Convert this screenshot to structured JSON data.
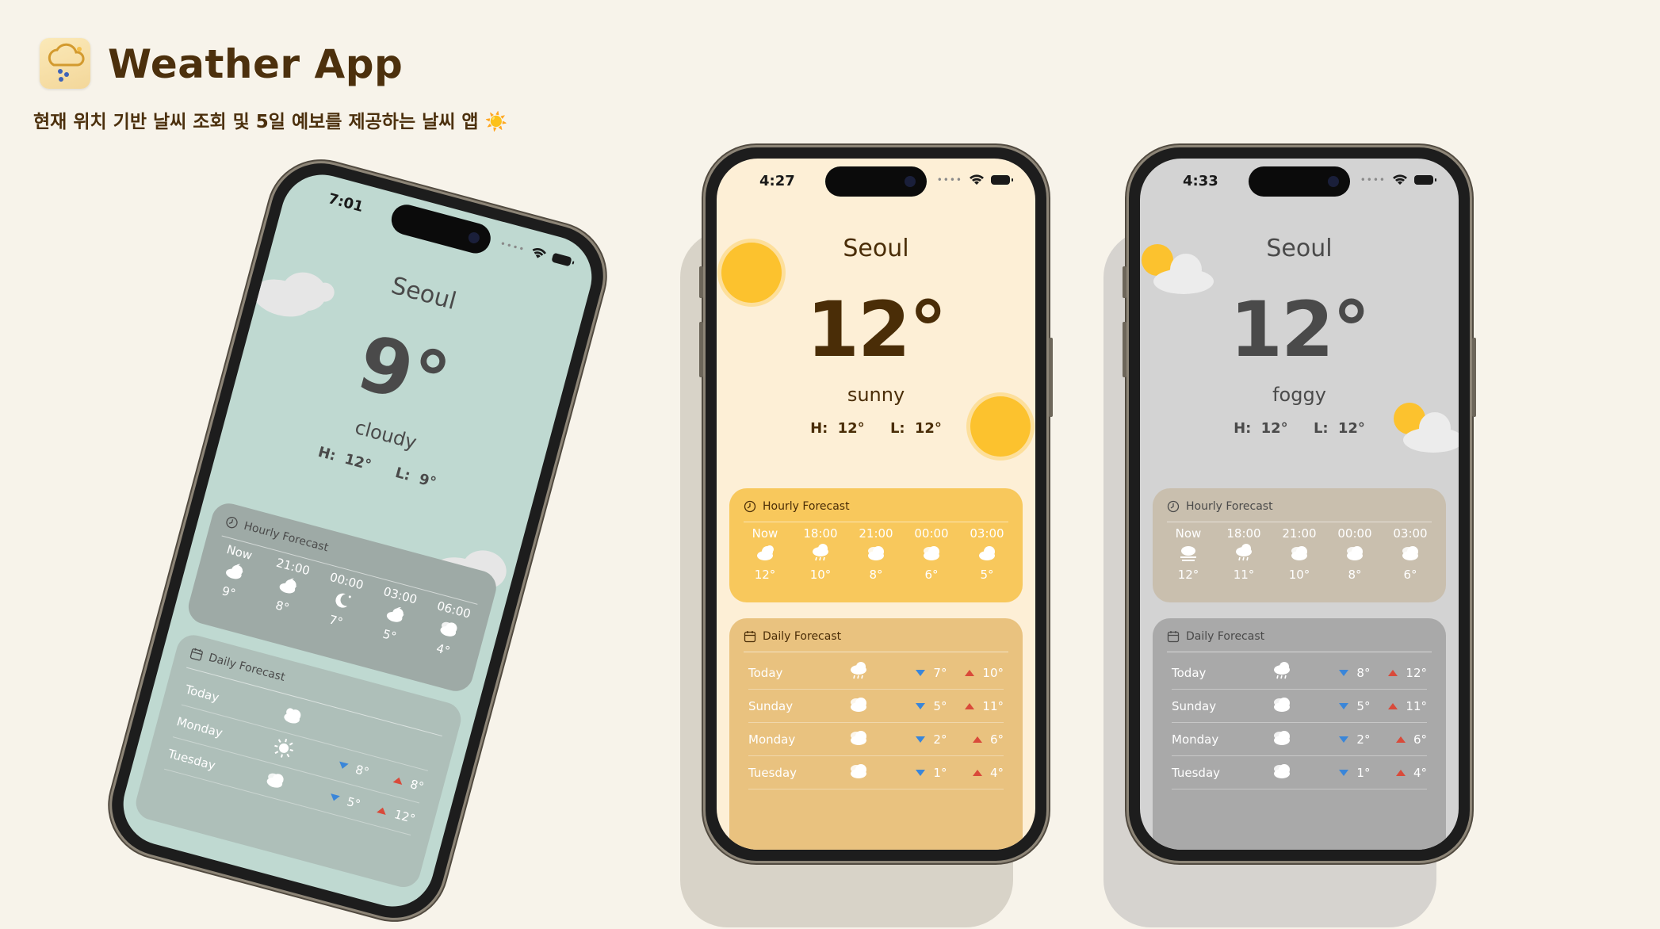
{
  "header": {
    "title": "Weather App",
    "subtitle": "현재 위치 기반 날씨 조회 및 5일 예보를 제공하는 날씨 앱 ☀️"
  },
  "phones": [
    {
      "time": "7:01",
      "city": "Seoul",
      "temp": "9°",
      "condition": "cloudy",
      "high": "H: 12°",
      "low": "L: 9°",
      "hourly_title": "Hourly Forecast",
      "hourly": [
        {
          "time": "Now",
          "icon": "cloud-moon-icon",
          "temp": "9°"
        },
        {
          "time": "21:00",
          "icon": "cloud-moon-icon",
          "temp": "8°"
        },
        {
          "time": "00:00",
          "icon": "moon-stars-icon",
          "temp": "7°"
        },
        {
          "time": "03:00",
          "icon": "cloud-moon-icon",
          "temp": "5°"
        },
        {
          "time": "06:00",
          "icon": "clouds-icon",
          "temp": "4°"
        }
      ],
      "daily_title": "Daily Forecast",
      "daily": [
        {
          "day": "Today",
          "icon": "sun-cloud-icon",
          "low": "",
          "high": ""
        },
        {
          "day": "Monday",
          "icon": "sun-icon",
          "low": "8°",
          "high": "8°"
        },
        {
          "day": "Tuesday",
          "icon": "clouds-icon",
          "low": "5°",
          "high": "12°"
        }
      ],
      "colors": {
        "bg": "#bfd9d1",
        "text": "#4a4a4a",
        "hourly": "#9eaaa6",
        "daily": "#aebfb9"
      }
    },
    {
      "time": "4:27",
      "city": "Seoul",
      "temp": "12°",
      "condition": "sunny",
      "high": "H: 12°",
      "low": "L: 12°",
      "hourly_title": "Hourly Forecast",
      "hourly": [
        {
          "time": "Now",
          "icon": "cloud-sun-icon",
          "temp": "12°"
        },
        {
          "time": "18:00",
          "icon": "cloud-rain-icon",
          "temp": "10°"
        },
        {
          "time": "21:00",
          "icon": "clouds-icon",
          "temp": "8°"
        },
        {
          "time": "00:00",
          "icon": "clouds-icon",
          "temp": "6°"
        },
        {
          "time": "03:00",
          "icon": "cloud-icon",
          "temp": "5°"
        }
      ],
      "daily_title": "Daily Forecast",
      "daily": [
        {
          "day": "Today",
          "icon": "cloud-rain-icon",
          "low": "7°",
          "high": "10°"
        },
        {
          "day": "Sunday",
          "icon": "clouds-icon",
          "low": "5°",
          "high": "11°"
        },
        {
          "day": "Monday",
          "icon": "clouds-icon",
          "low": "2°",
          "high": "6°"
        },
        {
          "day": "Tuesday",
          "icon": "clouds-icon",
          "low": "1°",
          "high": "4°"
        }
      ],
      "colors": {
        "bg": "#fdefd6",
        "text": "#4a2d07",
        "hourly": "#f8c85c",
        "daily": "#e9c27f"
      }
    },
    {
      "time": "4:33",
      "city": "Seoul",
      "temp": "12°",
      "condition": "foggy",
      "high": "H: 12°",
      "low": "L: 12°",
      "hourly_title": "Hourly Forecast",
      "hourly": [
        {
          "time": "Now",
          "icon": "fog-icon",
          "temp": "12°"
        },
        {
          "time": "18:00",
          "icon": "cloud-rain-icon",
          "temp": "11°"
        },
        {
          "time": "21:00",
          "icon": "clouds-icon",
          "temp": "10°"
        },
        {
          "time": "00:00",
          "icon": "clouds-icon",
          "temp": "8°"
        },
        {
          "time": "03:00",
          "icon": "clouds-icon",
          "temp": "6°"
        }
      ],
      "daily_title": "Daily Forecast",
      "daily": [
        {
          "day": "Today",
          "icon": "cloud-rain-icon",
          "low": "8°",
          "high": "12°"
        },
        {
          "day": "Sunday",
          "icon": "clouds-icon",
          "low": "5°",
          "high": "11°"
        },
        {
          "day": "Monday",
          "icon": "clouds-icon",
          "low": "2°",
          "high": "6°"
        },
        {
          "day": "Tuesday",
          "icon": "clouds-icon",
          "low": "1°",
          "high": "4°"
        }
      ],
      "colors": {
        "bg": "#d3d3d3",
        "text": "#4a4a4a",
        "hourly": "#c9bfae",
        "daily": "#a9a9a9"
      }
    }
  ]
}
